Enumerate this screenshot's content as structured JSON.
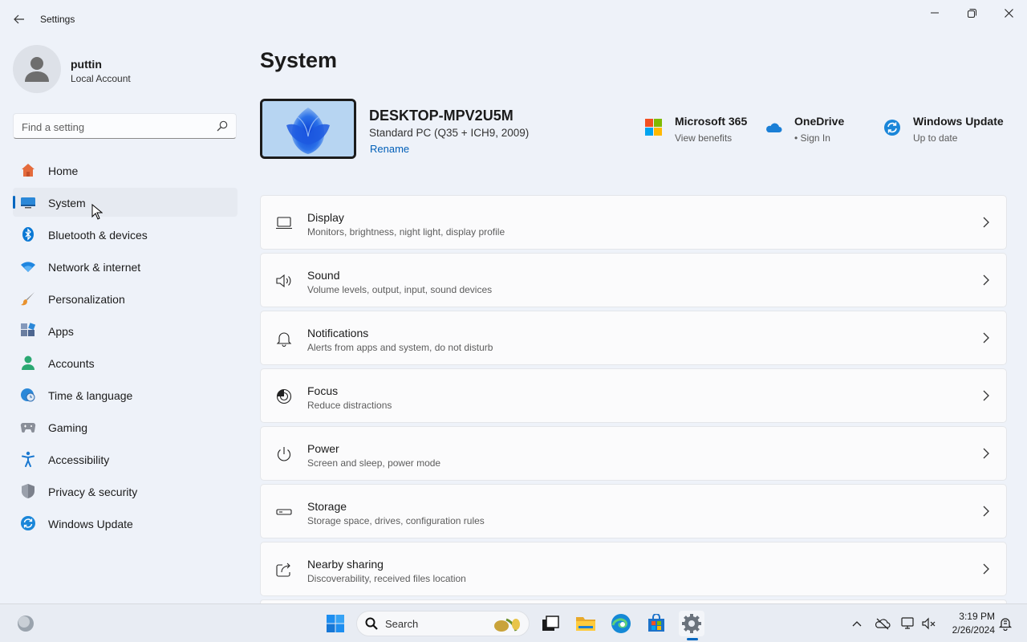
{
  "window": {
    "title": "Settings"
  },
  "profile": {
    "name": "puttin",
    "account_type": "Local Account"
  },
  "search": {
    "placeholder": "Find a setting"
  },
  "nav": {
    "items": [
      {
        "label": "Home",
        "icon": "home-icon",
        "active": false
      },
      {
        "label": "System",
        "icon": "system-icon",
        "active": true
      },
      {
        "label": "Bluetooth & devices",
        "icon": "bluetooth-icon",
        "active": false
      },
      {
        "label": "Network & internet",
        "icon": "wifi-icon",
        "active": false
      },
      {
        "label": "Personalization",
        "icon": "brush-icon",
        "active": false
      },
      {
        "label": "Apps",
        "icon": "apps-icon",
        "active": false
      },
      {
        "label": "Accounts",
        "icon": "accounts-icon",
        "active": false
      },
      {
        "label": "Time & language",
        "icon": "globe-clock-icon",
        "active": false
      },
      {
        "label": "Gaming",
        "icon": "gamepad-icon",
        "active": false
      },
      {
        "label": "Accessibility",
        "icon": "accessibility-icon",
        "active": false
      },
      {
        "label": "Privacy & security",
        "icon": "shield-icon",
        "active": false
      },
      {
        "label": "Windows Update",
        "icon": "update-icon",
        "active": false
      }
    ]
  },
  "main": {
    "title": "System",
    "device": {
      "name": "DESKTOP-MPV2U5M",
      "description": "Standard PC (Q35 + ICH9, 2009)",
      "rename_label": "Rename"
    },
    "quick_links": [
      {
        "title": "Microsoft 365",
        "subtitle": "View benefits",
        "icon": "microsoft-logo-icon"
      },
      {
        "title": "OneDrive",
        "subtitle": "• Sign In",
        "icon": "onedrive-cloud-icon"
      },
      {
        "title": "Windows Update",
        "subtitle": "Up to date",
        "icon": "update-icon"
      }
    ],
    "cards": [
      {
        "title": "Display",
        "subtitle": "Monitors, brightness, night light, display profile",
        "icon": "display-icon"
      },
      {
        "title": "Sound",
        "subtitle": "Volume levels, output, input, sound devices",
        "icon": "speaker-icon"
      },
      {
        "title": "Notifications",
        "subtitle": "Alerts from apps and system, do not disturb",
        "icon": "bell-icon"
      },
      {
        "title": "Focus",
        "subtitle": "Reduce distractions",
        "icon": "focus-icon"
      },
      {
        "title": "Power",
        "subtitle": "Screen and sleep, power mode",
        "icon": "power-icon"
      },
      {
        "title": "Storage",
        "subtitle": "Storage space, drives, configuration rules",
        "icon": "storage-icon"
      },
      {
        "title": "Nearby sharing",
        "subtitle": "Discoverability, received files location",
        "icon": "share-icon"
      }
    ]
  },
  "taskbar": {
    "search_label": "Search",
    "time": "3:19 PM",
    "date": "2/26/2024"
  },
  "colors": {
    "accent": "#0067c0",
    "background": "#eef2f9",
    "card": "#fbfbfc",
    "link": "#005fb8"
  }
}
